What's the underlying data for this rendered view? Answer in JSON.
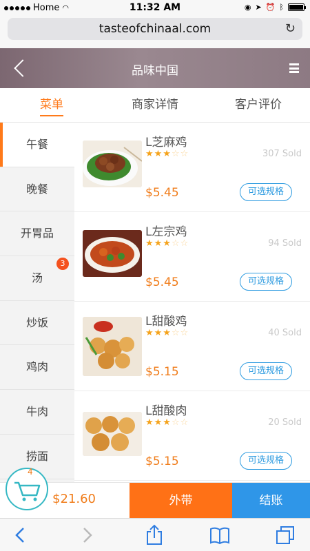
{
  "status_bar": {
    "carrier": "Home",
    "time": "11:32 AM"
  },
  "browser": {
    "url": "tasteofchinaal.com"
  },
  "header": {
    "title": "品味中国"
  },
  "tabs": [
    {
      "label": "菜单",
      "active": true
    },
    {
      "label": "商家详情",
      "active": false
    },
    {
      "label": "客户评价",
      "active": false
    }
  ],
  "sidebar": {
    "items": [
      {
        "label": "午餐"
      },
      {
        "label": "晚餐"
      },
      {
        "label": "开胃品"
      },
      {
        "label": "汤",
        "badge": "3"
      },
      {
        "label": "炒饭"
      },
      {
        "label": "鸡肉"
      },
      {
        "label": "牛肉"
      },
      {
        "label": "捞面"
      }
    ]
  },
  "dishes": [
    {
      "name": "L芝麻鸡",
      "rating": 3,
      "rating_max": 5,
      "sold": "307 Sold",
      "price": "$5.45",
      "option_label": "可选规格"
    },
    {
      "name": "L左宗鸡",
      "rating": 3,
      "rating_max": 5,
      "sold": "94 Sold",
      "price": "$5.45",
      "option_label": "可选规格"
    },
    {
      "name": "L甜酸鸡",
      "rating": 3,
      "rating_max": 5,
      "sold": "40 Sold",
      "price": "$5.15",
      "option_label": "可选规格"
    },
    {
      "name": "L甜酸肉",
      "rating": 3,
      "rating_max": 5,
      "sold": "20 Sold",
      "price": "$5.15",
      "option_label": "可选规格"
    }
  ],
  "cart": {
    "count": "4",
    "total": "$21.60",
    "takeout_label": "外带",
    "checkout_label": "结账"
  },
  "colors": {
    "accent": "#ff7a1a",
    "blue": "#2f96e8",
    "cart_ring": "#35b8c4"
  }
}
